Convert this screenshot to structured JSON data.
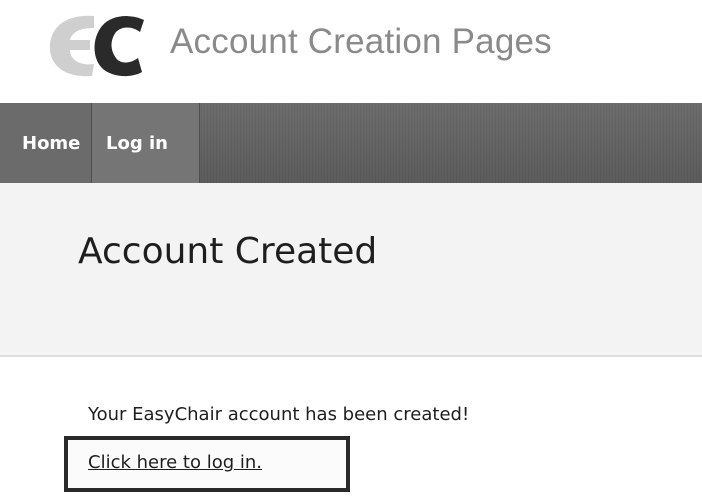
{
  "header": {
    "logo_icon": "easychair-ec-logo-icon",
    "title": "Account Creation Pages"
  },
  "nav": {
    "items": [
      {
        "label": "Home"
      },
      {
        "label": "Log in"
      }
    ]
  },
  "page": {
    "title": "Account Created",
    "message": "Your EasyChair account has been created!",
    "login_link_label": "Click here to log in."
  },
  "colors": {
    "navbar": "#666666",
    "title_gray": "#8a8a8a",
    "heading_band": "#f3f3f3",
    "logo_light": "#cfcfcf",
    "logo_dark": "#2a2a2a"
  }
}
